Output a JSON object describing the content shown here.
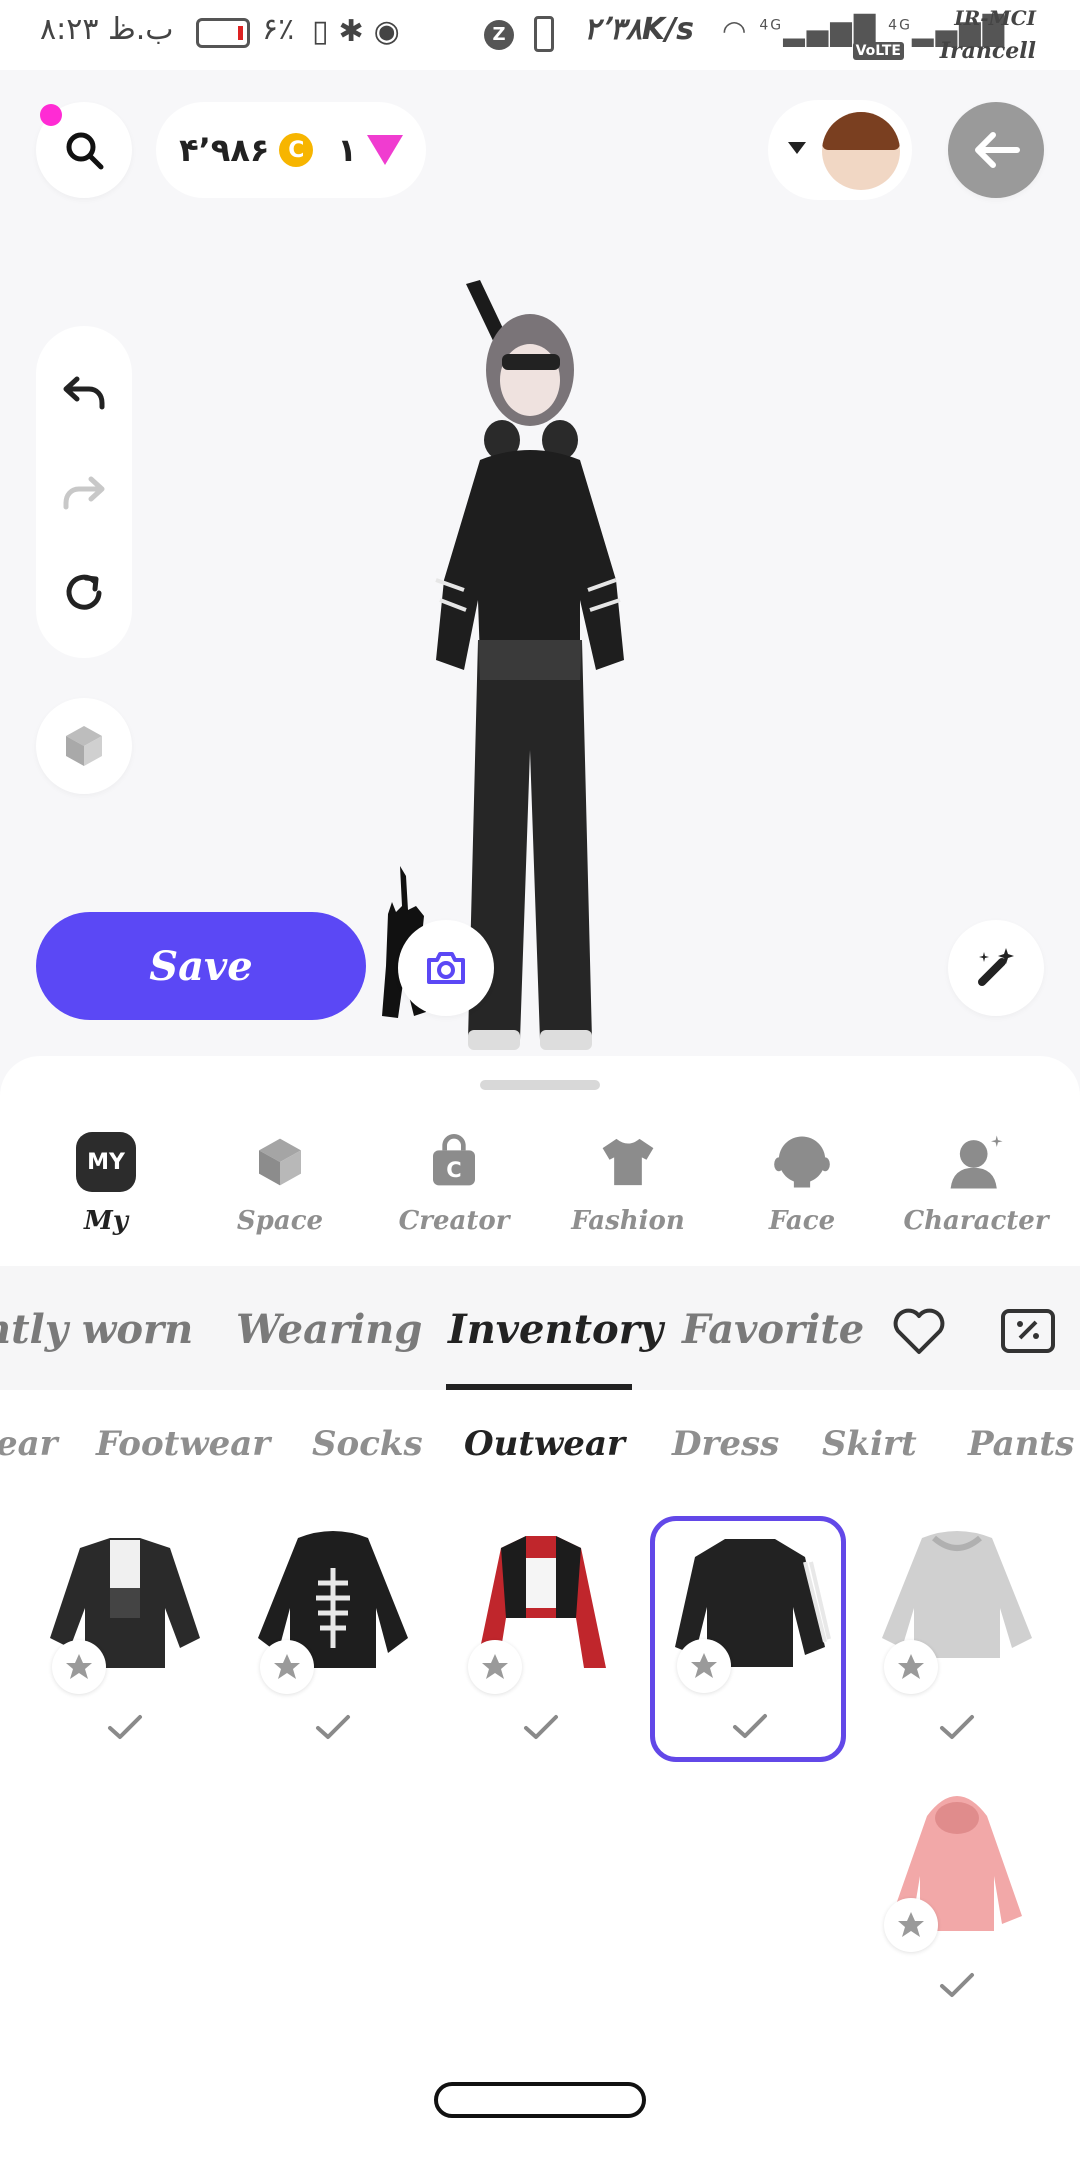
{
  "status_bar": {
    "time": "۸:۲۳ ب.ظ",
    "battery_percent": "۶٪",
    "speed": "۲٬۳۸K/s",
    "carrier_1": "IR-MCI",
    "carrier_2": "Irancell",
    "volte": "VoLTE",
    "net_1": "4G",
    "net_2": "4G"
  },
  "header": {
    "coins": "۴٬۹۸۶",
    "coin_symbol": "C",
    "gems": "۱"
  },
  "actions": {
    "save_label": "Save"
  },
  "categories": [
    {
      "label": "My",
      "badge": "MY",
      "icon": "my-badge-icon"
    },
    {
      "label": "Space",
      "icon": "cube-icon"
    },
    {
      "label": "Creator",
      "icon": "creator-bag-icon"
    },
    {
      "label": "Fashion",
      "icon": "tshirt-icon"
    },
    {
      "label": "Face",
      "icon": "face-icon"
    },
    {
      "label": "Character",
      "icon": "character-icon"
    }
  ],
  "tabs": [
    "ntly worn",
    "Wearing",
    "Inventory",
    "Favorite"
  ],
  "active_tab": "Inventory",
  "subtabs": [
    "ear",
    "Footwear",
    "Socks",
    "Outwear",
    "Dress",
    "Skirt",
    "Pants"
  ],
  "active_subtab": "Outwear",
  "items": [
    {
      "name": "black-white-moto-jacket",
      "color": "#2a2a2a"
    },
    {
      "name": "skeleton-hoodie",
      "color": "#1e1e1e"
    },
    {
      "name": "red-racing-jacket",
      "color": "#c0262c"
    },
    {
      "name": "black-track-jacket",
      "color": "#222222"
    },
    {
      "name": "grey-cropped-hoodie",
      "color": "#d0d0d0"
    },
    {
      "name": "pink-hooded-robe",
      "color": "#f2a8a8"
    }
  ],
  "colors": {
    "accent": "#5b48f5",
    "selected_border": "#6248e8",
    "notification": "#ff2bd4",
    "coin": "#f7b500",
    "gem": "#f03cd0"
  }
}
